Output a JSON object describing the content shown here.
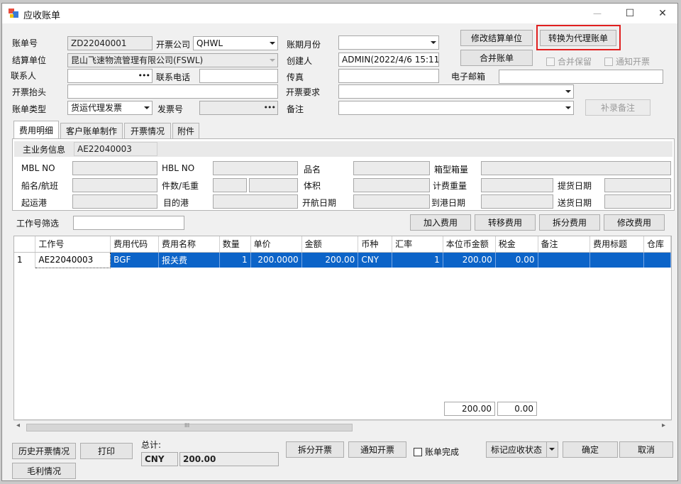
{
  "window": {
    "title": "应收账单",
    "minimize": "—",
    "maximize": "☐",
    "close": "✕"
  },
  "header": {
    "bill_no_label": "账单号",
    "bill_no": "ZD22040001",
    "invoice_company_label": "开票公司",
    "invoice_company": "QHWL",
    "period_label": "账期月份",
    "period": "",
    "settle_unit_label": "结算单位",
    "settle_unit": "昆山飞速物流管理有限公司(FSWL)",
    "creator_label": "创建人",
    "creator": "ADMIN(2022/4/6 15:11:",
    "contact_label": "联系人",
    "contact": "",
    "phone_label": "联系电话",
    "phone": "",
    "fax_label": "传真",
    "fax": "",
    "email_label": "电子邮箱",
    "email": "",
    "invoice_title_label": "开票抬头",
    "invoice_title": "",
    "invoice_req_label": "开票要求",
    "invoice_req": "",
    "bill_type_label": "账单类型",
    "bill_type": "货运代理发票",
    "invoice_no_label": "发票号",
    "invoice_no": "",
    "remark_label": "备注",
    "remark": ""
  },
  "top_buttons": {
    "modify_settle": "修改结算单位",
    "convert_agent": "转换为代理账单",
    "merge_bill": "合并账单",
    "supplement_remark": "补录备注",
    "merge_keep": "合并保留",
    "notify_invoice": "通知开票"
  },
  "tabs": [
    "费用明细",
    "客户账单制作",
    "开票情况",
    "附件"
  ],
  "info": {
    "main_biz_label": "主业务信息",
    "main_biz": "AE22040003",
    "mbl_label": "MBL NO",
    "hbl_label": "HBL NO",
    "goods_label": "品名",
    "box_label": "箱型箱量",
    "vessel_label": "船名/航班",
    "pieces_label": "件数/毛重",
    "volume_label": "体积",
    "charge_weight_label": "计费重量",
    "pickup_label": "提货日期",
    "origin_label": "起运港",
    "dest_label": "目的港",
    "sail_label": "开航日期",
    "arrive_label": "到港日期",
    "deliver_label": "送货日期"
  },
  "filter": {
    "label": "工作号筛选",
    "value": ""
  },
  "fee_buttons": {
    "add": "加入费用",
    "transfer": "转移费用",
    "split": "拆分费用",
    "modify": "修改费用"
  },
  "grid": {
    "columns": [
      "",
      "工作号",
      "费用代码",
      "费用名称",
      "数量",
      "单价",
      "金额",
      "币种",
      "汇率",
      "本位币金额",
      "税金",
      "备注",
      "费用标题",
      "仓库"
    ],
    "rows": [
      [
        "1",
        "AE22040003",
        "BGF",
        "报关费",
        "1",
        "200.0000",
        "200.00",
        "CNY",
        "1",
        "200.00",
        "0.00",
        "",
        "",
        ""
      ]
    ],
    "total_amount": "200.00",
    "total_tax": "0.00",
    "scroll_left": "◂",
    "scroll_right": "▸",
    "scroll_grip": "III"
  },
  "bottom": {
    "history_invoice": "历史开票情况",
    "print": "打印",
    "gross_profit": "毛利情况",
    "total_label": "总计:",
    "currency": "CNY",
    "total": "200.00",
    "split_invoice": "拆分开票",
    "notify_invoice": "通知开票",
    "bill_complete": "账单完成",
    "mark_status": "标记应收状态",
    "confirm": "确定",
    "cancel": "取消"
  },
  "colors": {
    "selection": "#0c64c8",
    "highlight": "#e02020"
  }
}
